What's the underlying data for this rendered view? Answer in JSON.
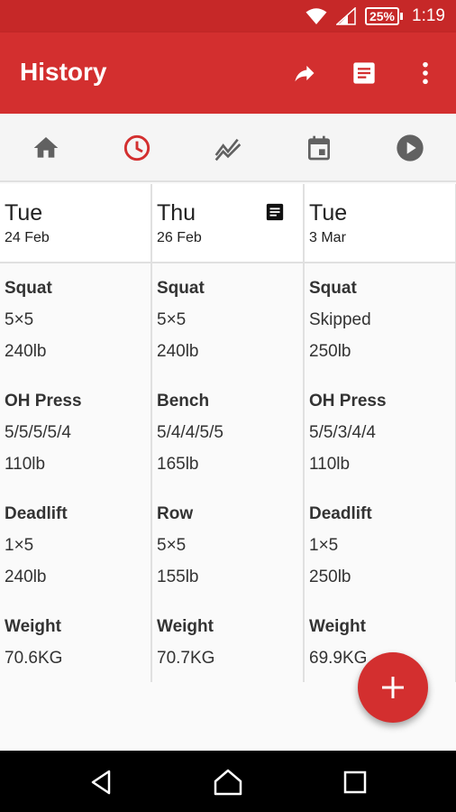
{
  "status_bar": {
    "battery": "25%",
    "time": "1:19"
  },
  "app_bar": {
    "title": "History",
    "actions": [
      "share-icon",
      "notes-icon",
      "more-vert-icon"
    ]
  },
  "nav_tabs": [
    {
      "icon": "home-icon",
      "active": false
    },
    {
      "icon": "history-icon",
      "active": true
    },
    {
      "icon": "graph-icon",
      "active": false
    },
    {
      "icon": "calendar-icon",
      "active": false
    },
    {
      "icon": "play-icon",
      "active": false
    }
  ],
  "colors": {
    "primary": "#d32f2f",
    "primary_dark": "#c62828",
    "active_tab": "#d32f2f",
    "inactive_tab": "#616161"
  },
  "workouts": [
    {
      "day": "Tue",
      "date": "24 Feb",
      "has_note": false,
      "exercises": [
        {
          "name": "Squat",
          "sets": "5×5",
          "weight": "240lb"
        },
        {
          "name": "OH Press",
          "sets": "5/5/5/5/4",
          "weight": "110lb"
        },
        {
          "name": "Deadlift",
          "sets": "1×5",
          "weight": "240lb"
        }
      ],
      "bodyweight": {
        "label": "Weight",
        "value": "70.6KG"
      }
    },
    {
      "day": "Thu",
      "date": "26 Feb",
      "has_note": true,
      "exercises": [
        {
          "name": "Squat",
          "sets": "5×5",
          "weight": "240lb"
        },
        {
          "name": "Bench",
          "sets": "5/4/4/5/5",
          "weight": "165lb"
        },
        {
          "name": "Row",
          "sets": "5×5",
          "weight": "155lb"
        }
      ],
      "bodyweight": {
        "label": "Weight",
        "value": "70.7KG"
      }
    },
    {
      "day": "Tue",
      "date": "3 Mar",
      "has_note": false,
      "exercises": [
        {
          "name": "Squat",
          "sets": "Skipped",
          "weight": "250lb"
        },
        {
          "name": "OH Press",
          "sets": "5/5/3/4/4",
          "weight": "110lb"
        },
        {
          "name": "Deadlift",
          "sets": "1×5",
          "weight": "250lb"
        }
      ],
      "bodyweight": {
        "label": "Weight",
        "value": "69.9KG"
      }
    }
  ],
  "fab": {
    "icon": "add-icon"
  },
  "system_nav": [
    "back-icon",
    "home-icon",
    "recents-icon"
  ]
}
